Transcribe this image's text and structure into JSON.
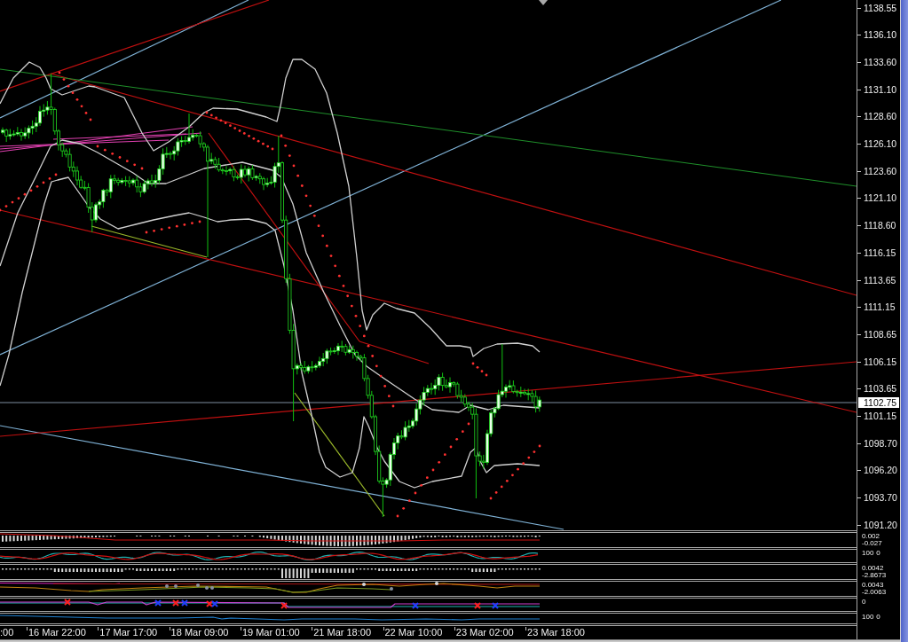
{
  "price_axis": {
    "labels": [
      "1138.55",
      "1136.10",
      "1133.60",
      "1131.10",
      "1128.60",
      "1126.10",
      "1123.60",
      "1121.10",
      "1118.60",
      "1116.15",
      "1113.65",
      "1111.15",
      "1108.65",
      "1106.15",
      "1103.65",
      "1101.15",
      "1098.70",
      "1096.20",
      "1093.70",
      "1091.20"
    ],
    "current_price": "1102.75"
  },
  "indicator_panels": [
    {
      "kind": "histogram",
      "scale_labels": [
        "0.002",
        "-0.027"
      ]
    },
    {
      "kind": "oscillator",
      "scale_labels": [
        "100",
        "0"
      ]
    },
    {
      "kind": "bars",
      "scale_labels": [
        "0.0042",
        "-2.8673"
      ]
    },
    {
      "kind": "envelope",
      "scale_labels": [
        "0.0043",
        "-2.0063"
      ]
    },
    {
      "kind": "signals",
      "scale_labels": [
        "0"
      ]
    },
    {
      "kind": "line",
      "scale_labels": [
        "100",
        "0"
      ]
    }
  ],
  "time_axis": {
    "labels": [
      ":00",
      "16 Mar 22:00",
      "17 Mar 17:00",
      "18 Mar 09:00",
      "19 Mar 01:00",
      "21 Mar 18:00",
      "22 Mar 10:00",
      "23 Mar 02:00",
      "23 Mar 18:00"
    ]
  }
}
